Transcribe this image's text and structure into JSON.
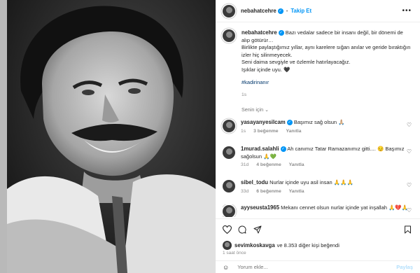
{
  "post": {
    "username": "nebahatcehre",
    "follow_label": "Takip Et",
    "more_glyph": "•••"
  },
  "caption": {
    "username": "nebahatcehre",
    "line1": "Bazı vedalar sadece bir insanı değil, bir dönemi de alıp götürür…",
    "line2": "Birlikte paylaştığımız yıllar, aynı karelere sığan anılar ve geride bıraktığın izler hiç silinmeyecek.",
    "line3": "Seni daima sevgiyle ve özlemle hatırlayacağız.",
    "line4": "Işıklar içinde uyu. 🖤",
    "hashtag": "#kadirinanır",
    "time": "1s"
  },
  "senin_icin": "Senin için ⌄",
  "comments": [
    {
      "user": "yasayanyesilcam",
      "verified": true,
      "text": "Başımız sağ olsun 🙏🏼",
      "time": "1s",
      "likes": "3 beğenme",
      "reply": "Yanıtla"
    },
    {
      "user": "1murad.salahli",
      "verified": true,
      "text": "Ah canımız Tatar Ramazanımız gitti.... 😔 Başımız sağolsun 🙏💚",
      "time": "31d",
      "likes": "4 beğenme",
      "reply": "Yanıtla"
    },
    {
      "user": "sibel_todu",
      "verified": false,
      "text": "Nurlar içinde uyu asil insan 🙏🙏🙏",
      "time": "33d",
      "likes": "6 beğenme",
      "reply": "Yanıtla"
    },
    {
      "user": "ayyseusta1965",
      "verified": false,
      "text": "Mekanı cennet olsun nurlar içinde yat inşallah 🙏💔🙏",
      "time": "",
      "likes": "",
      "reply": ""
    }
  ],
  "likes": {
    "user": "sevimkoskavga",
    "rest": "ve 8.353 diğer kişi beğendi"
  },
  "time_ago": "1 saat önce",
  "add_comment": {
    "placeholder": "Yorum ekle...",
    "post_label": "Paylaş"
  },
  "colors": {
    "accent": "#0095f6",
    "verified": "#0095f6",
    "hashtag": "#00376b",
    "muted": "#8e8e8e",
    "text": "#262626"
  }
}
